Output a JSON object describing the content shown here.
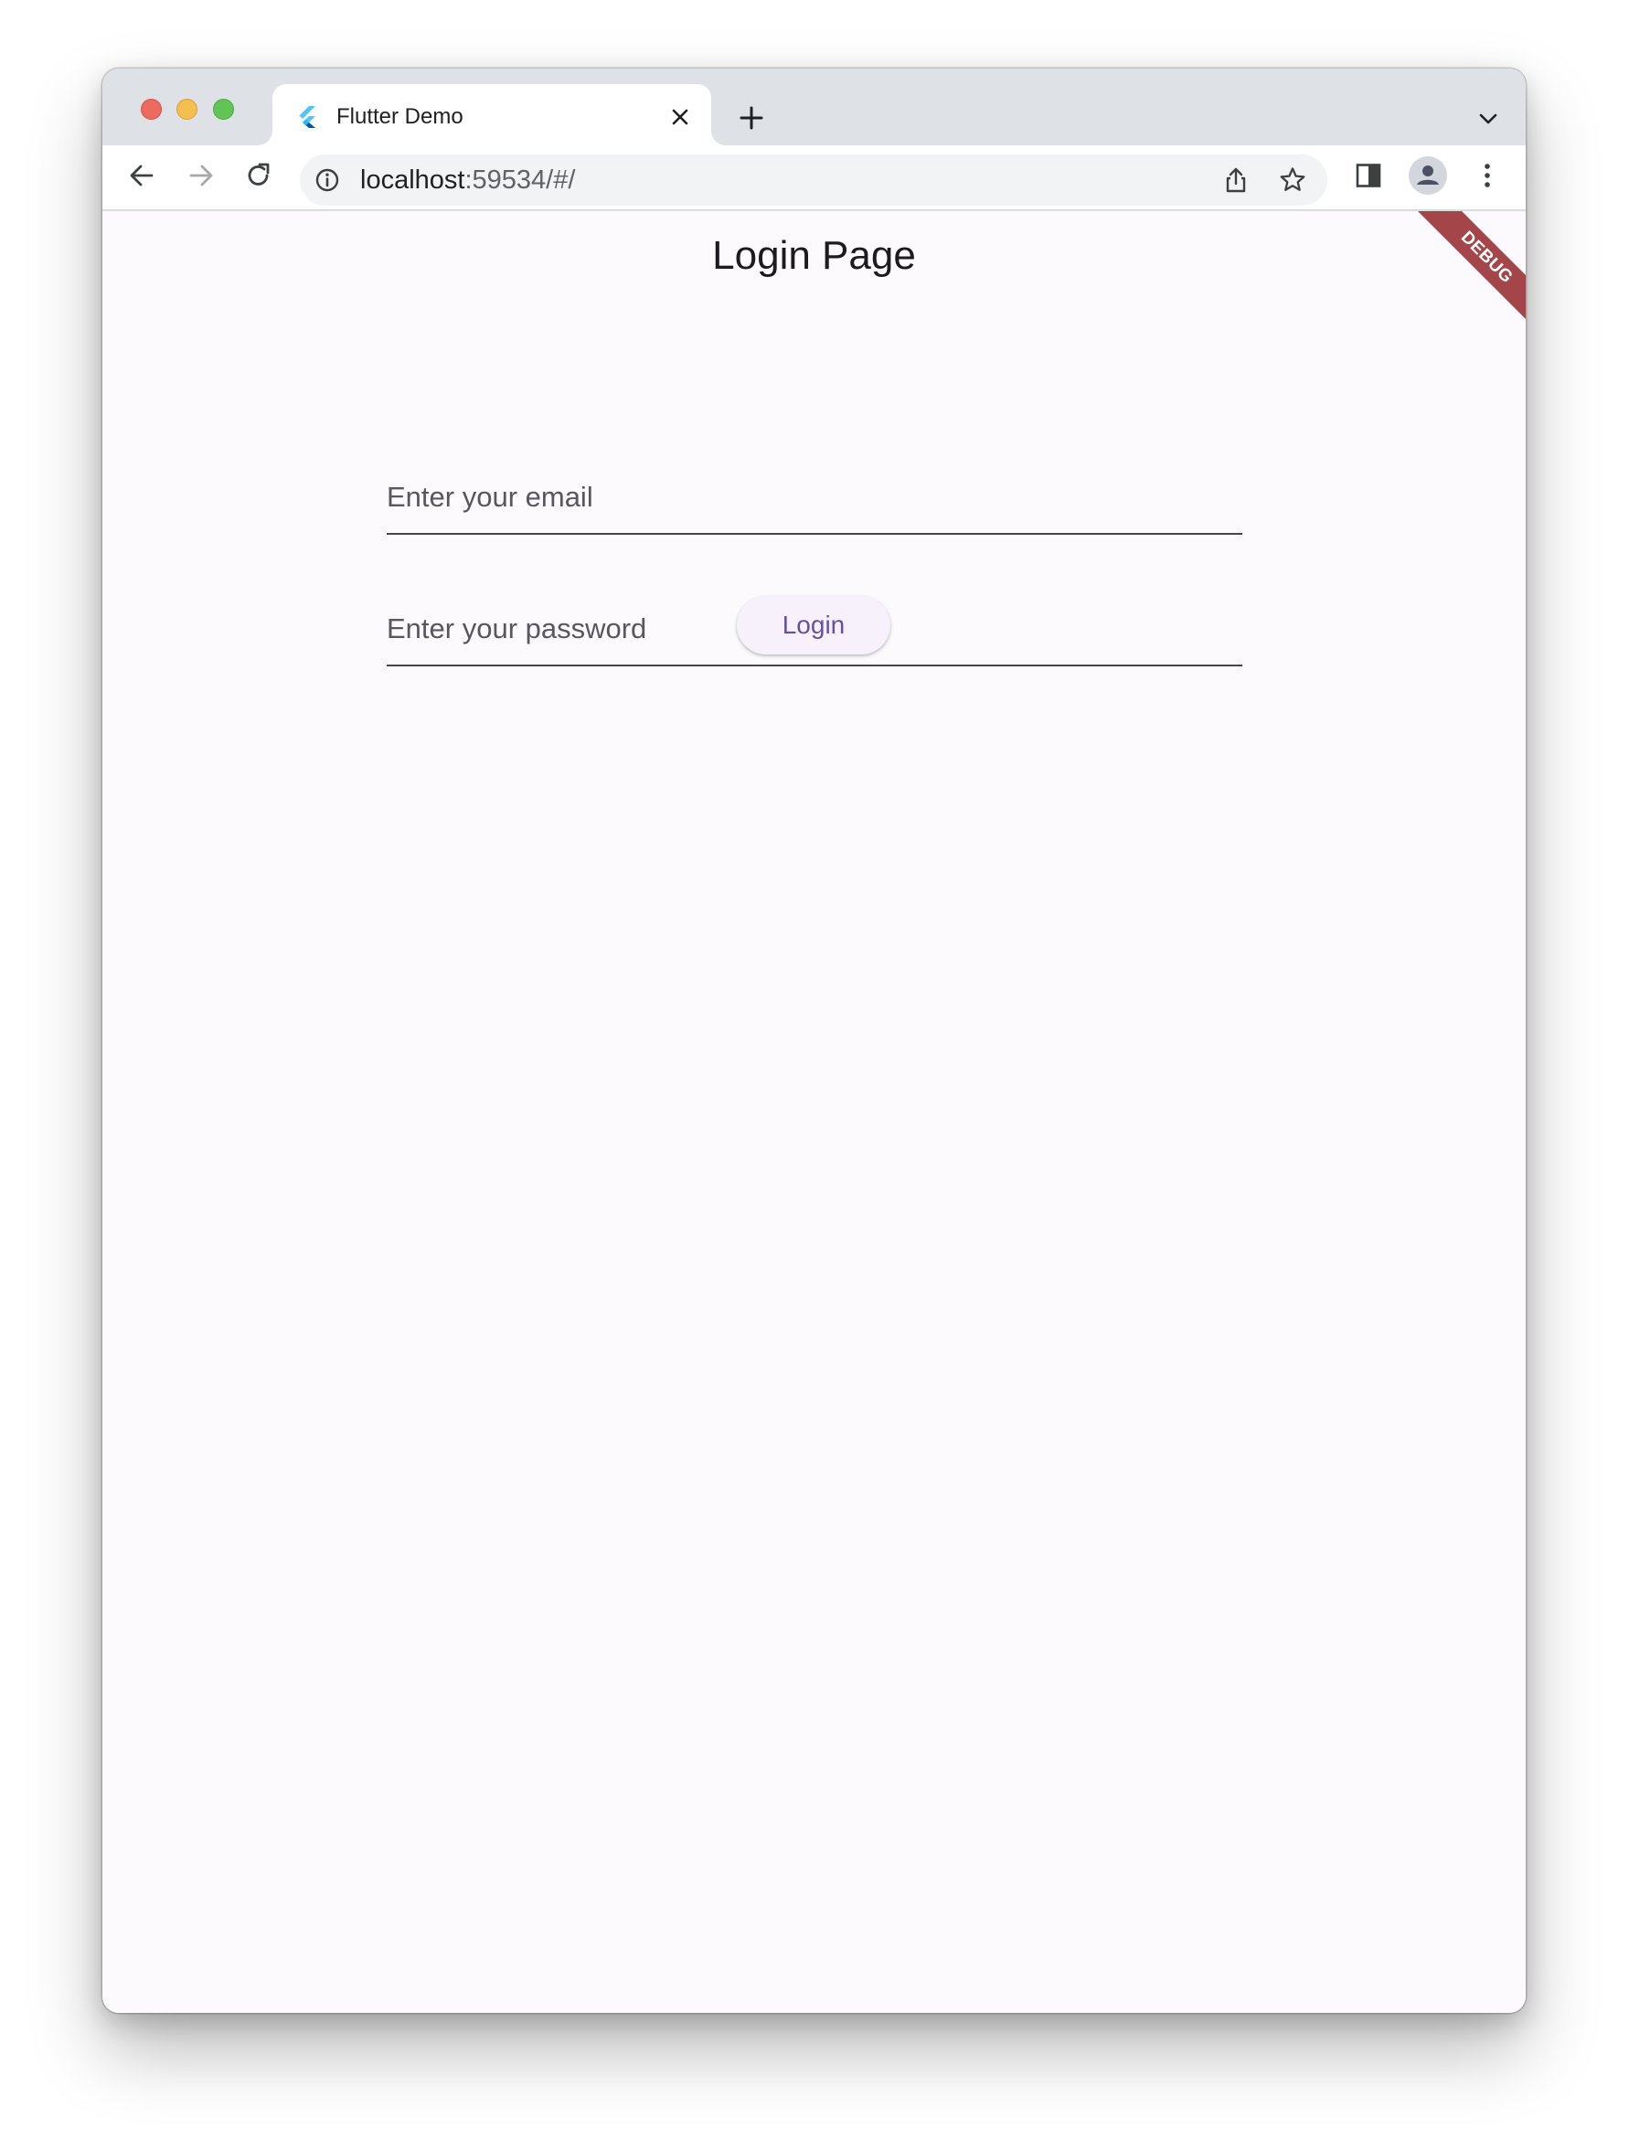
{
  "browser": {
    "tab_title": "Flutter Demo",
    "url_host": "localhost",
    "url_rest": ":59534/#/",
    "icons": {
      "favicon": "flutter-logo-icon",
      "tab_close": "close-icon",
      "new_tab": "plus-icon",
      "tab_search": "chevron-down-icon",
      "back": "arrow-left-icon",
      "forward": "arrow-right-icon",
      "reload": "reload-icon",
      "site_info": "info-icon",
      "share": "share-icon",
      "bookmark": "star-icon",
      "side_panel": "side-panel-icon",
      "profile": "profile-avatar-icon",
      "menu": "kebab-menu-icon"
    },
    "colors": {
      "close": "#ed6a5e",
      "minimize": "#f5bf4f",
      "maximize": "#61c554"
    }
  },
  "page": {
    "title": "Login Page",
    "email_placeholder": "Enter your email",
    "email_value": "",
    "password_placeholder": "Enter your password",
    "password_value": "",
    "login_label": "Login",
    "debug_label": "DEBUG",
    "colors": {
      "accent": "#6750a4",
      "debug_banner": "#a4454a",
      "background": "#fcfafd"
    }
  }
}
